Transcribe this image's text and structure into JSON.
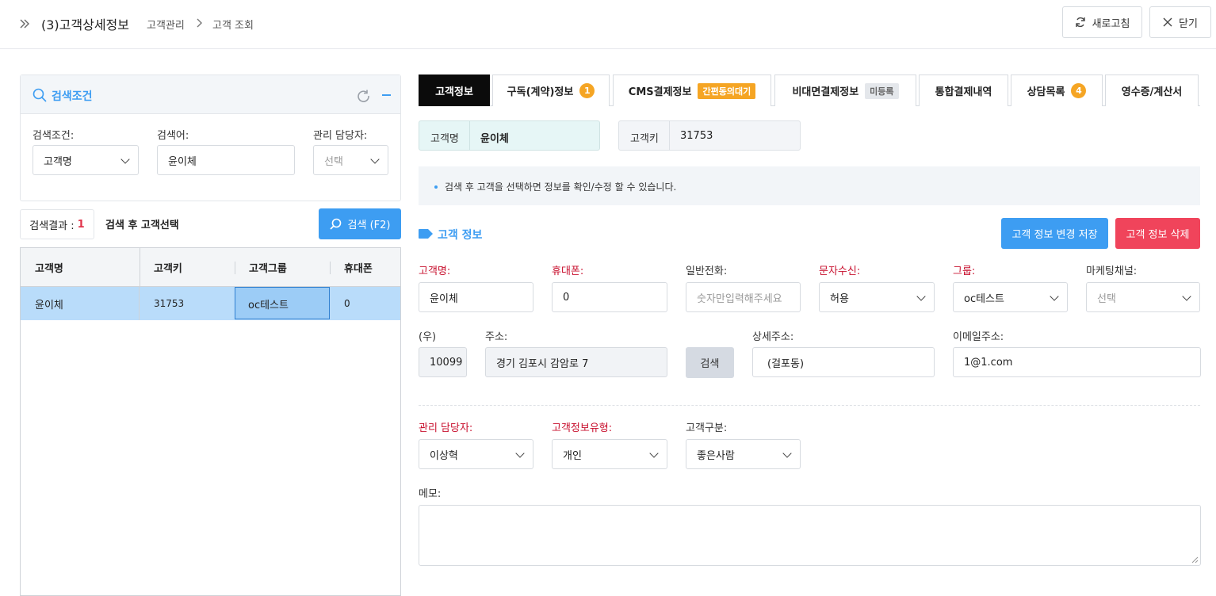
{
  "header": {
    "title": "(3)고객상세정보",
    "breadcrumb": [
      "고객관리",
      "고객 조회"
    ],
    "refresh_label": "새로고침",
    "close_label": "닫기"
  },
  "search_panel": {
    "title": "검색조건",
    "condition_label": "검색조건:",
    "condition_value": "고객명",
    "keyword_label": "검색어:",
    "keyword_value": "윤이체",
    "manager_label": "관리 담당자:",
    "manager_placeholder": "선택"
  },
  "result": {
    "label": "검색결과 :",
    "count": "1",
    "hint": "검색 후 고객선택",
    "search_button": "검색 (F2)",
    "columns": [
      "고객명",
      "고객키",
      "고객그룹",
      "휴대폰"
    ],
    "rows": [
      {
        "name": "윤이체",
        "key": "31753",
        "group": "oc테스트",
        "phone": "0"
      }
    ]
  },
  "tabs": [
    {
      "label": "고객정보"
    },
    {
      "label": "구독(계약)정보",
      "badge": "1"
    },
    {
      "label": "CMS결제정보",
      "tag": "간편동의대기"
    },
    {
      "label": "비대면결제정보",
      "tag": "미등록"
    },
    {
      "label": "통합결제내역"
    },
    {
      "label": "상담목록",
      "badge": "4"
    },
    {
      "label": "영수증/계산서"
    }
  ],
  "summary": {
    "name_label": "고객명",
    "name_value": "윤이체",
    "key_label": "고객키",
    "key_value": "31753"
  },
  "notice": "검색 후 고객을 선택하면 정보를 확인/수정 할 수 있습니다.",
  "section": {
    "title": "고객 정보",
    "save_button": "고객 정보 변경 저장",
    "delete_button": "고객 정보 삭제"
  },
  "form": {
    "name_label": "고객명:",
    "name_value": "윤이체",
    "mobile_label": "휴대폰:",
    "mobile_value": "0",
    "phone_label": "일반전화:",
    "phone_placeholder": "숫자만입력해주세요",
    "sms_label": "문자수신:",
    "sms_value": "허용",
    "group_label": "그룹:",
    "group_value": "oc테스트",
    "marketing_label": "마케팅채널:",
    "marketing_placeholder": "선택",
    "zip_label": "(우)",
    "zip_value": "10099",
    "address_label": "주소:",
    "address_value": "경기 김포시 감암로 7",
    "address_search_button": "검색",
    "detail_label": "상세주소:",
    "detail_value": "(걸포동)",
    "email_label": "이메일주소:",
    "email_value": "1@1.com",
    "manager_label": "관리 담당자:",
    "manager_value": "이상혁",
    "type_label": "고객정보유형:",
    "type_value": "개인",
    "category_label": "고객구분:",
    "category_value": "좋은사람",
    "memo_label": "메모:",
    "memo_value": ""
  },
  "colors": {
    "accent_blue": "#3d9df2",
    "danger_red": "#f0445b",
    "badge_orange": "#f5a524",
    "selected_row": "#b9dcfa"
  }
}
